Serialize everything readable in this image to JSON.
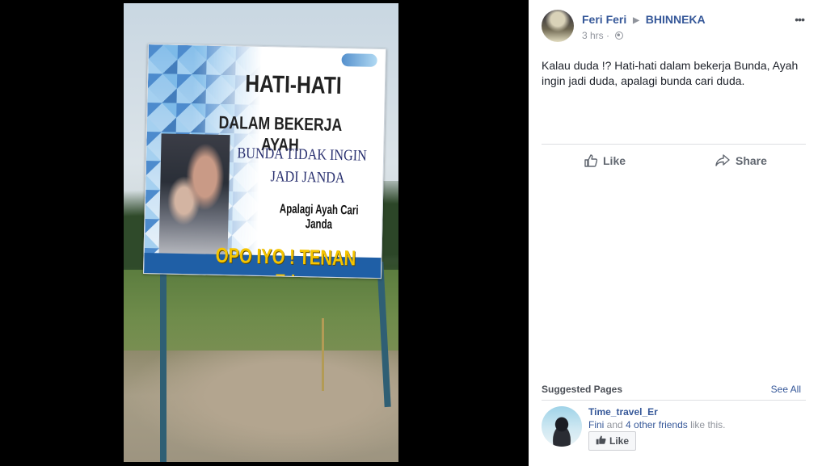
{
  "photo": {
    "sign": {
      "line1": "HATI-HATI",
      "line2": "DALAM BEKERJA AYAH",
      "line3": "BUNDA TIDAK INGIN",
      "line4": "JADI JANDA",
      "line5": "Apalagi Ayah Cari Janda",
      "line6": "OPO IYO ! TENAN E !"
    }
  },
  "post": {
    "author": "Feri Feri",
    "target": "BHINNEKA",
    "time": "3 hrs",
    "privacy_icon": "globe-icon",
    "more_label": "•••",
    "text": "Kalau duda !? Hati-hati dalam bekerja Bunda, Ayah ingin jadi duda, apalagi bunda cari duda.",
    "actions": {
      "like": "Like",
      "share": "Share"
    }
  },
  "suggested": {
    "title": "Suggested Pages",
    "see_all": "See All",
    "page": {
      "name": "Time_travel_Er",
      "friend": "Fini",
      "and_text": " and ",
      "others": "4 other friends",
      "tail": " like this.",
      "like_button": "Like"
    }
  },
  "colors": {
    "link": "#365899",
    "muted": "#90949c",
    "text": "#1d2129",
    "sign_yellow": "#f5c400",
    "sign_blue": "#1f5fa6"
  }
}
